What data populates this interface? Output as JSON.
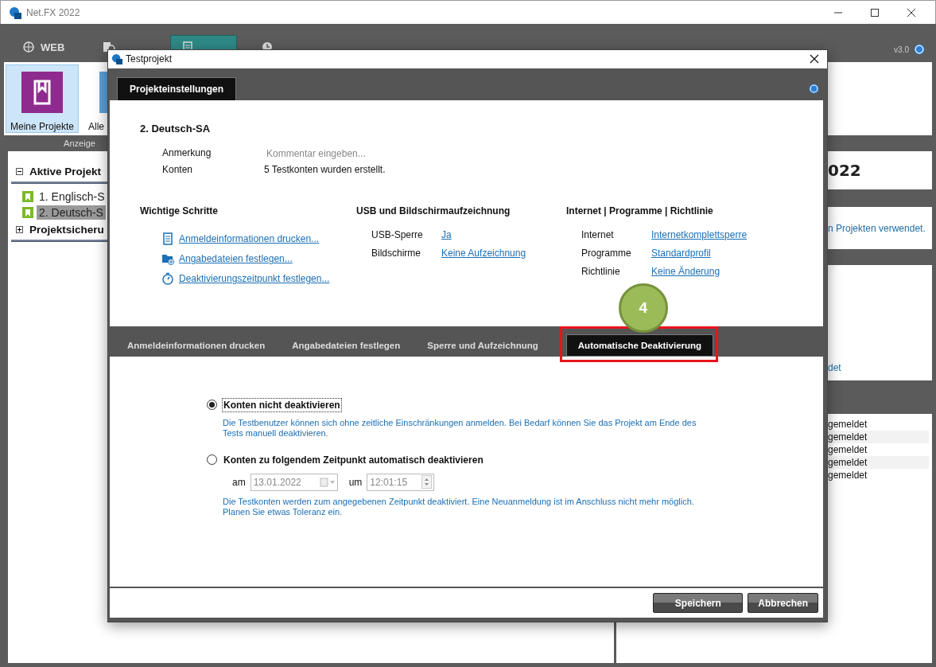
{
  "window": {
    "title": "Net.FX 2022"
  },
  "nav_tabs": [
    {
      "label": "WEB",
      "selected": false
    },
    {
      "selected": false
    },
    {
      "selected": true
    },
    {
      "selected": false
    }
  ],
  "version": "v3.0",
  "ribbon": {
    "items": [
      {
        "label": "Meine Projekte",
        "selected": true
      },
      {
        "label": "Alle",
        "selected": false
      }
    ],
    "group_label": "Anzeige"
  },
  "tree": [
    {
      "label": "Aktive Projekt",
      "expanded": true,
      "children": [
        {
          "label": "1. Englisch-S",
          "selected": false
        },
        {
          "label": "2. Deutsch-S",
          "selected": true
        }
      ]
    },
    {
      "label": "Projektsicheru",
      "expanded": false
    }
  ],
  "right_panel": {
    "heading": "022",
    "note": "n Projekten verwendet.",
    "link": "det",
    "list": [
      "gemeldet",
      "gemeldet",
      "gemeldet",
      "gemeldet",
      "gemeldet"
    ]
  },
  "dialog": {
    "title": "Testprojekt",
    "header_tab": "Projekteinstellungen",
    "project_name": "2. Deutsch-SA",
    "fields": [
      {
        "label": "Anmerkung",
        "placeholder": "Kommentar eingeben..."
      },
      {
        "label": "Konten",
        "value": "5 Testkonten wurden erstellt."
      }
    ],
    "sections": [
      {
        "title": "Wichtige Schritte",
        "kind": "links",
        "items": [
          {
            "label": "Anmeldeinformationen drucken..."
          },
          {
            "label": "Angabedateien festlegen..."
          },
          {
            "label": "Deaktivierungszeitpunkt festlegen..."
          }
        ]
      },
      {
        "title": "USB und Bildschirmaufzeichnung",
        "kind": "pairs",
        "items": [
          {
            "label": "USB-Sperre",
            "value": "Ja"
          },
          {
            "label": "Bildschirme",
            "value": "Keine Aufzeichnung"
          }
        ]
      },
      {
        "title": "Internet | Programme | Richtlinie",
        "kind": "pairs",
        "items": [
          {
            "label": "Internet",
            "value": "Internetkomplettsperre"
          },
          {
            "label": "Programme",
            "value": "Standardprofil"
          },
          {
            "label": "Richtlinie",
            "value": "Keine Änderung"
          }
        ]
      }
    ],
    "tabs": [
      {
        "label": "Anmeldeinformationen drucken",
        "selected": false,
        "highlighted": false
      },
      {
        "label": "Angabedateien festlegen",
        "selected": false,
        "highlighted": false
      },
      {
        "label": "Sperre und Aufzeichnung",
        "selected": false,
        "highlighted": false
      },
      {
        "label": "Automatische Deaktivierung",
        "selected": true,
        "highlighted": true
      }
    ],
    "callout": "4",
    "options": [
      {
        "label": "Konten nicht deaktivieren",
        "selected": true,
        "focused": true,
        "description": "Die Testbenutzer können sich ohne zeitliche Einschränkungen anmelden. Bei Bedarf können Sie das Projekt am Ende des Tests manuell deaktivieren."
      },
      {
        "label": "Konten zu folgendem Zeitpunkt automatisch deaktivieren",
        "selected": false,
        "focused": false,
        "date_label": "am",
        "date": "13.01.2022",
        "time_label": "um",
        "time": "12:01:15",
        "disabled": true,
        "description": "Die Testkonten werden zum angegebenen Zeitpunkt deaktiviert. Eine Neuanmeldung ist im Anschluss nicht mehr möglich. Planen Sie etwas Toleranz ein."
      }
    ],
    "buttons": [
      "Speichern",
      "Abbrechen"
    ]
  }
}
